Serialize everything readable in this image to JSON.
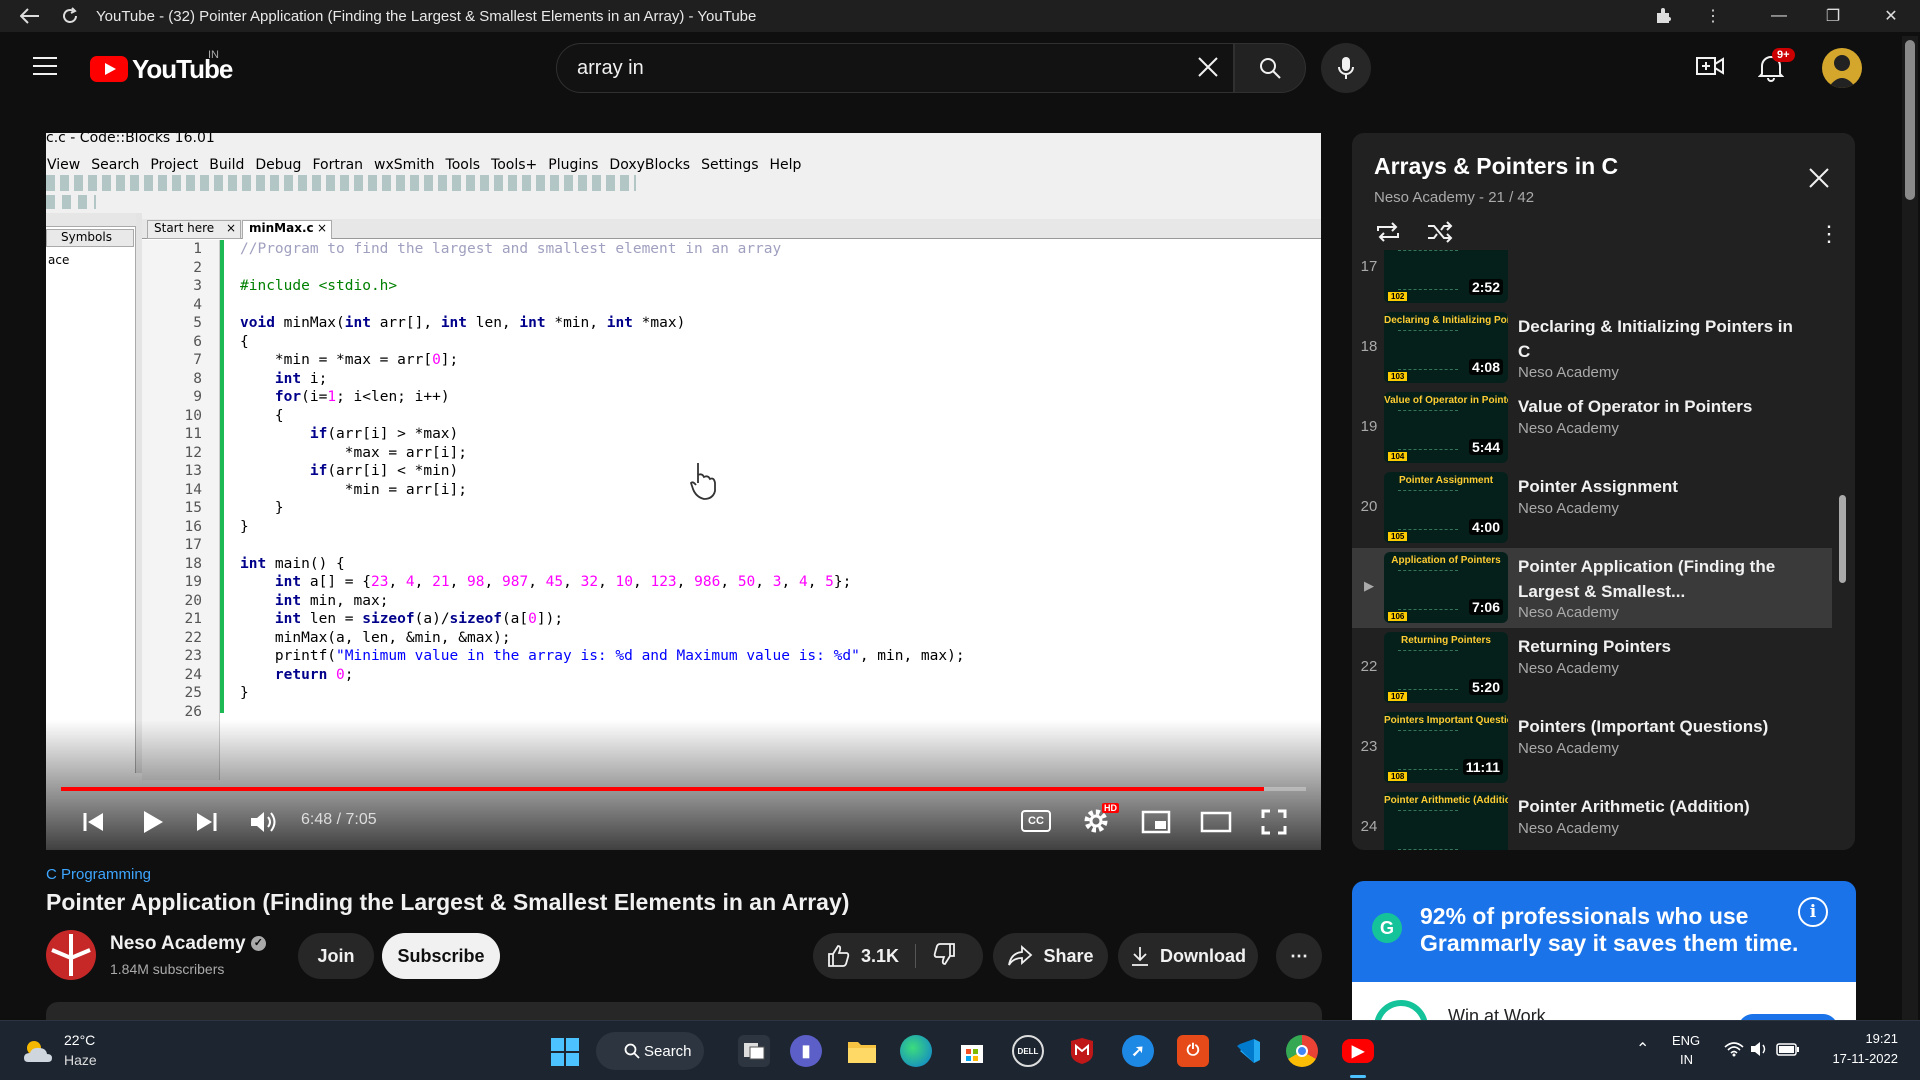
{
  "browser": {
    "title": "YouTube - (32) Pointer Application (Finding the Largest & Smallest Elements in an Array) - YouTube"
  },
  "header": {
    "logo_text": "YouTube",
    "logo_country": "IN",
    "search_value": "array in",
    "notifications_badge": "9+"
  },
  "video": {
    "ide": {
      "window_title": "c.c - Code::Blocks 16.01",
      "menu": [
        "View",
        "Search",
        "Project",
        "Build",
        "Debug",
        "Fortran",
        "wxSmith",
        "Tools",
        "Tools+",
        "Plugins",
        "DoxyBlocks",
        "Settings",
        "Help"
      ],
      "tabs": [
        "Start here",
        "minMax.c"
      ],
      "side_tab": "Symbols",
      "side_item": "ace",
      "line_numbers": [
        "1",
        "2",
        "3",
        "4",
        "5",
        "6",
        "7",
        "8",
        "9",
        "10",
        "11",
        "12",
        "13",
        "14",
        "15",
        "16",
        "17",
        "18",
        "19",
        "20",
        "21",
        "22",
        "23",
        "24",
        "25",
        "26"
      ],
      "code": [
        "//Program to find the largest and smallest element in an array",
        "",
        "#include <stdio.h>",
        "",
        "void minMax(int arr[], int len, int *min, int *max)",
        "{",
        "    *min = *max = arr[0];",
        "    int i;",
        "    for(i=1; i<len; i++)",
        "    {",
        "        if(arr[i] > *max)",
        "            *max = arr[i];",
        "        if(arr[i] < *min)",
        "            *min = arr[i];",
        "    }",
        "}",
        "",
        "int main() {",
        "    int a[] = {23, 4, 21, 98, 987, 45, 32, 10, 123, 986, 50, 3, 4, 5};",
        "    int min, max;",
        "    int len = sizeof(a)/sizeof(a[0]);",
        "    minMax(a, len, &min, &max);",
        "    printf(\"Minimum value in the array is: %d and Maximum value is: %d\", min, max);",
        "    return 0;",
        "}",
        ""
      ]
    },
    "time_display": "6:48 / 7:05",
    "progress_fraction": 0.966,
    "cc_label": "CC",
    "hd_badge": "HD"
  },
  "below": {
    "category": "C Programming",
    "title": "Pointer Application (Finding the Largest & Smallest Elements in an Array)",
    "channel": "Neso Academy",
    "subscribers": "1.84M subscribers",
    "join": "Join",
    "subscribe": "Subscribe",
    "likes": "3.1K",
    "share": "Share",
    "download": "Download"
  },
  "playlist": {
    "title": "Arrays & Pointers in C",
    "meta": "Neso Academy - 21 / 42",
    "items": [
      {
        "num": "17",
        "title": "",
        "channel": "Neso Academy",
        "duration": "2:52",
        "thumb_title": "",
        "tag": "102"
      },
      {
        "num": "18",
        "title": "Declaring & Initializing Pointers in C",
        "channel": "Neso Academy",
        "duration": "4:08",
        "thumb_title": "Declaring & Initializing Pointers",
        "tag": "103"
      },
      {
        "num": "19",
        "title": "Value of Operator in Pointers",
        "channel": "Neso Academy",
        "duration": "5:44",
        "thumb_title": "Value of Operator in Pointers",
        "tag": "104"
      },
      {
        "num": "20",
        "title": "Pointer Assignment",
        "channel": "Neso Academy",
        "duration": "4:00",
        "thumb_title": "Pointer Assignment",
        "tag": "105"
      },
      {
        "num": "▶",
        "title": "Pointer Application (Finding the Largest & Smallest...",
        "channel": "Neso Academy",
        "duration": "7:06",
        "thumb_title": "Application of Pointers",
        "tag": "106"
      },
      {
        "num": "22",
        "title": "Returning Pointers",
        "channel": "Neso Academy",
        "duration": "5:20",
        "thumb_title": "Returning Pointers",
        "tag": "107"
      },
      {
        "num": "23",
        "title": "Pointers (Important Questions)",
        "channel": "Neso Academy",
        "duration": "11:11",
        "thumb_title": "Pointers Important Questions",
        "tag": "108"
      },
      {
        "num": "24",
        "title": "Pointer Arithmetic (Addition)",
        "channel": "Neso Academy",
        "duration": "",
        "thumb_title": "Pointer Arithmetic (Addition)",
        "tag": ""
      }
    ]
  },
  "ad": {
    "text": "92% of professionals who use Grammarly say it saves them time.",
    "sub": "Win at Work"
  },
  "taskbar": {
    "weather_temp": "22°C",
    "weather_desc": "Haze",
    "search": "Search",
    "lang_top": "ENG",
    "lang_bottom": "IN",
    "time": "19:21",
    "date": "17-11-2022"
  },
  "colors": {
    "accent_red": "#ff0000",
    "link_blue": "#3ea6ff",
    "grammarly": "#1a73e8"
  }
}
